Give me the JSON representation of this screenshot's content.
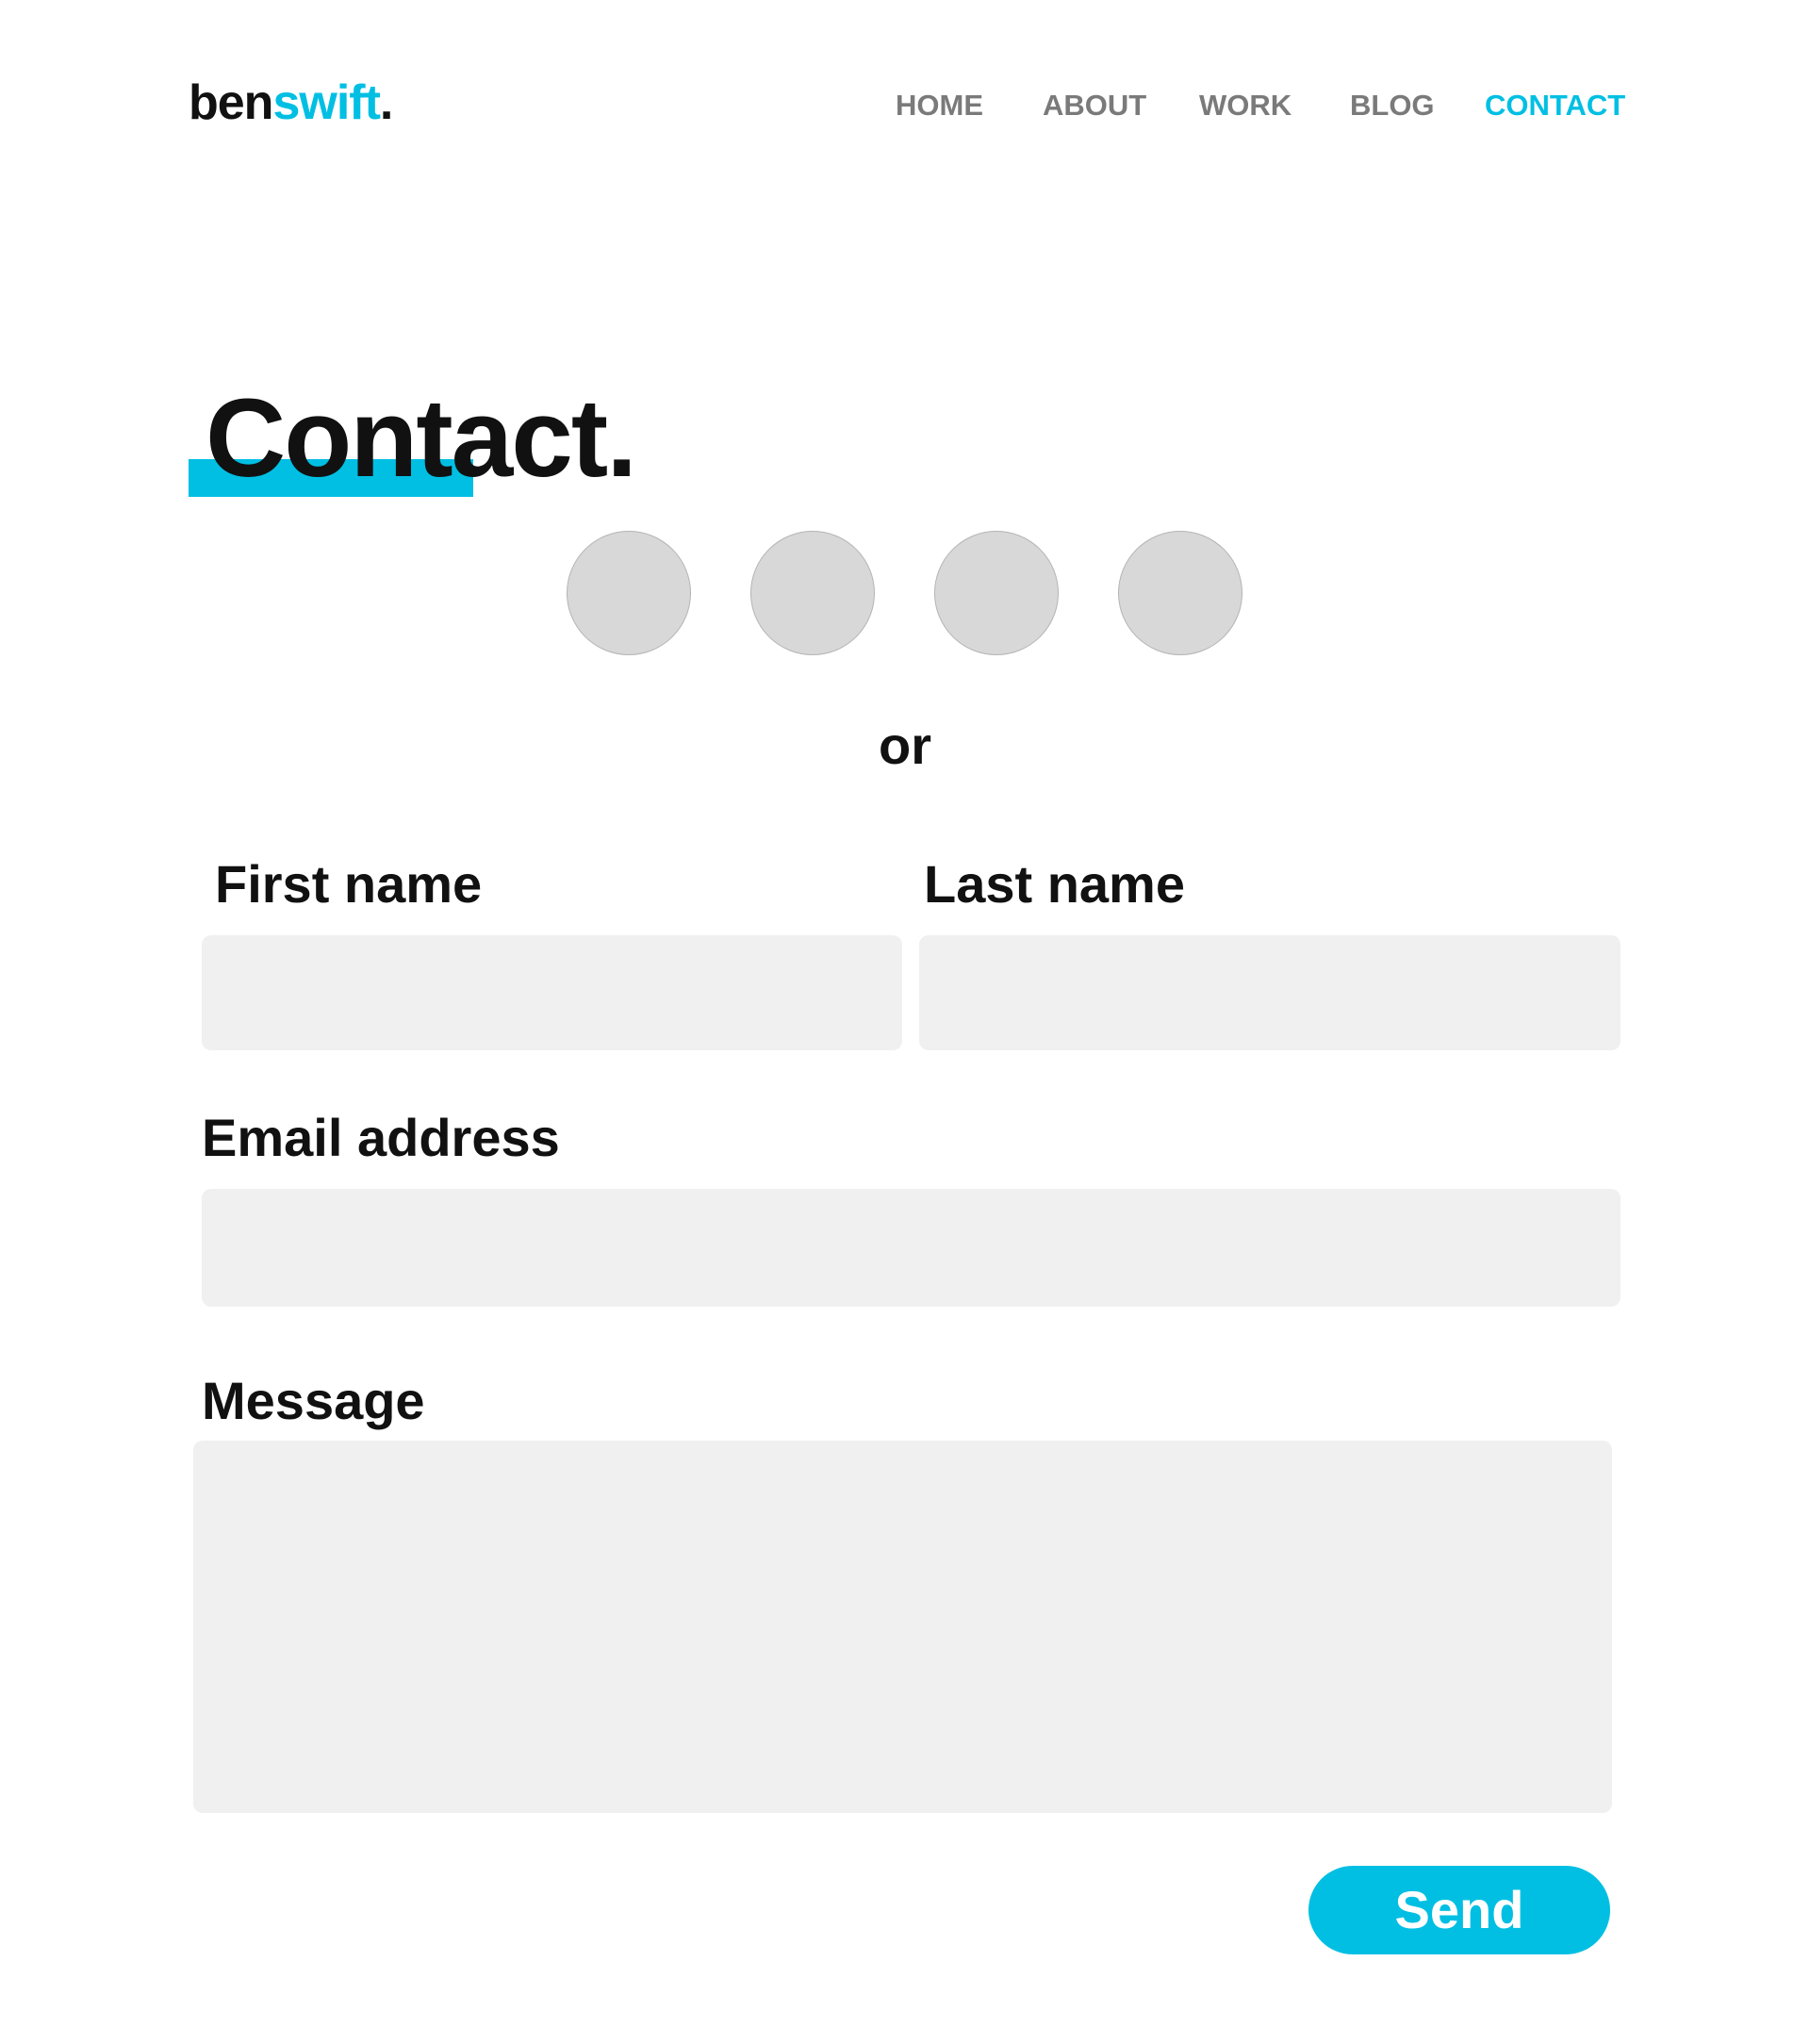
{
  "header": {
    "logo": {
      "part1": "ben",
      "part2": "swift",
      "dot": "."
    },
    "nav": [
      {
        "label": "HOME"
      },
      {
        "label": "ABOUT"
      },
      {
        "label": "WORK"
      },
      {
        "label": "BLOG"
      },
      {
        "label": "CONTACT",
        "active": true
      }
    ]
  },
  "page": {
    "title": "Contact."
  },
  "social": {
    "icons": [
      "social-icon-1",
      "social-icon-2",
      "social-icon-3",
      "social-icon-4"
    ]
  },
  "divider_text": "or",
  "form": {
    "first_name": {
      "label": "First name",
      "value": ""
    },
    "last_name": {
      "label": "Last name",
      "value": ""
    },
    "email": {
      "label": "Email address",
      "value": ""
    },
    "message": {
      "label": "Message",
      "value": ""
    },
    "send_label": "Send"
  },
  "colors": {
    "accent": "#00bfe3",
    "nav_inactive": "#7a7a7a",
    "field_bg": "#eff0ef",
    "social_placeholder": "#d8d8d8",
    "text": "#111111"
  }
}
